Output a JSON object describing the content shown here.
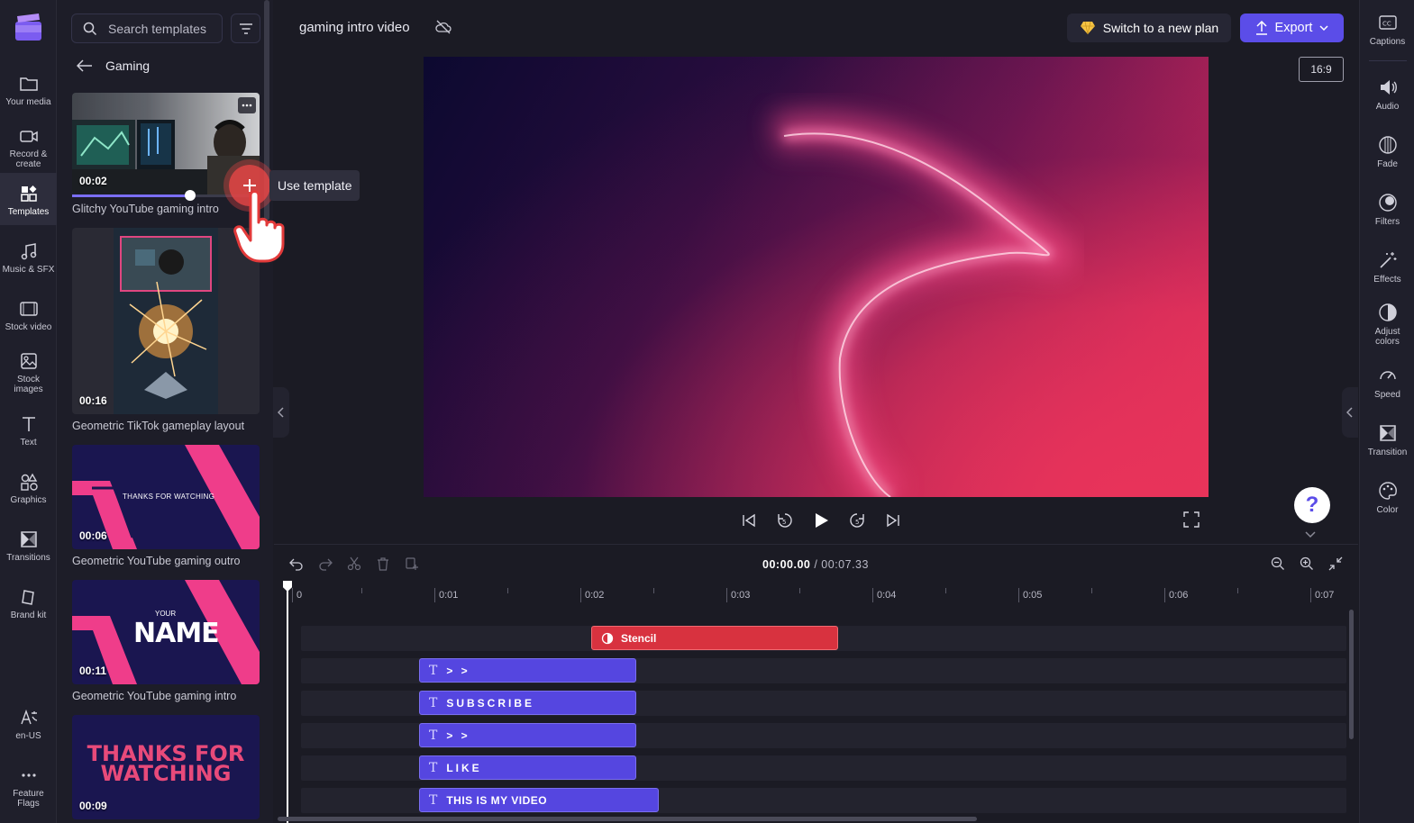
{
  "left_nav": {
    "items": [
      {
        "label": "Your media",
        "icon": "folder-icon"
      },
      {
        "label": "Record &\ncreate",
        "icon": "camera-icon"
      },
      {
        "label": "Templates",
        "icon": "templates-icon",
        "active": true
      },
      {
        "label": "Music & SFX",
        "icon": "music-icon"
      },
      {
        "label": "Stock video",
        "icon": "film-icon"
      },
      {
        "label": "Stock\nimages",
        "icon": "image-icon"
      },
      {
        "label": "Text",
        "icon": "text-icon"
      },
      {
        "label": "Graphics",
        "icon": "shapes-icon"
      },
      {
        "label": "Transitions",
        "icon": "transition-icon"
      },
      {
        "label": "Brand kit",
        "icon": "brand-kit-icon"
      }
    ],
    "bottom": [
      {
        "label": "en-US",
        "icon": "language-icon"
      },
      {
        "label": "Feature\nFlags",
        "icon": "more-icon"
      }
    ]
  },
  "templates_panel": {
    "search_placeholder": "Search templates",
    "back_title": "Gaming",
    "tooltip": "Use template",
    "progress": 0.63,
    "items": [
      {
        "duration": "00:02",
        "caption": "Glitchy YouTube gaming intro"
      },
      {
        "duration": "00:16",
        "caption": "Geometric TikTok gameplay layout"
      },
      {
        "duration": "00:06",
        "caption": "Geometric YouTube gaming outro",
        "overlay": "THANKS FOR WATCHING"
      },
      {
        "duration": "00:11",
        "caption": "Geometric YouTube gaming intro",
        "overlay_small": "YOUR",
        "overlay_big": "NAME"
      },
      {
        "duration": "00:09",
        "overlay": "THANKS FOR\nWATCHING"
      }
    ]
  },
  "header": {
    "project_title": "gaming intro video",
    "plan_button": "Switch to a new plan",
    "export_button": "Export",
    "aspect_ratio": "16:9"
  },
  "right_rail": {
    "items": [
      {
        "label": "Captions",
        "icon": "captions-icon"
      },
      {
        "label": "Audio",
        "icon": "speaker-icon"
      },
      {
        "label": "Fade",
        "icon": "fade-icon"
      },
      {
        "label": "Filters",
        "icon": "filters-icon"
      },
      {
        "label": "Effects",
        "icon": "magic-wand-icon"
      },
      {
        "label": "Adjust\ncolors",
        "icon": "contrast-icon"
      },
      {
        "label": "Speed",
        "icon": "speedometer-icon"
      },
      {
        "label": "Transition",
        "icon": "transition-icon"
      },
      {
        "label": "Color",
        "icon": "palette-icon"
      }
    ]
  },
  "timeline": {
    "current_time": "00:00.00",
    "total_time": "/ 00:07.33",
    "ticks": [
      "0",
      "0:01",
      "0:02",
      "0:03",
      "0:04",
      "0:05",
      "0:06",
      "0:07"
    ],
    "clips": [
      {
        "label": "Stencil",
        "type": "stencil"
      },
      {
        "label": "> >",
        "type": "text"
      },
      {
        "label": "SUBSCRIBE",
        "type": "text"
      },
      {
        "label": "> >",
        "type": "text"
      },
      {
        "label": "LIKE",
        "type": "text"
      },
      {
        "label": "THIS IS MY VIDEO",
        "type": "text"
      }
    ]
  },
  "colors": {
    "accent": "#5b4de8",
    "text_clip": "#5546e0",
    "stencil_clip": "#d8323f"
  }
}
